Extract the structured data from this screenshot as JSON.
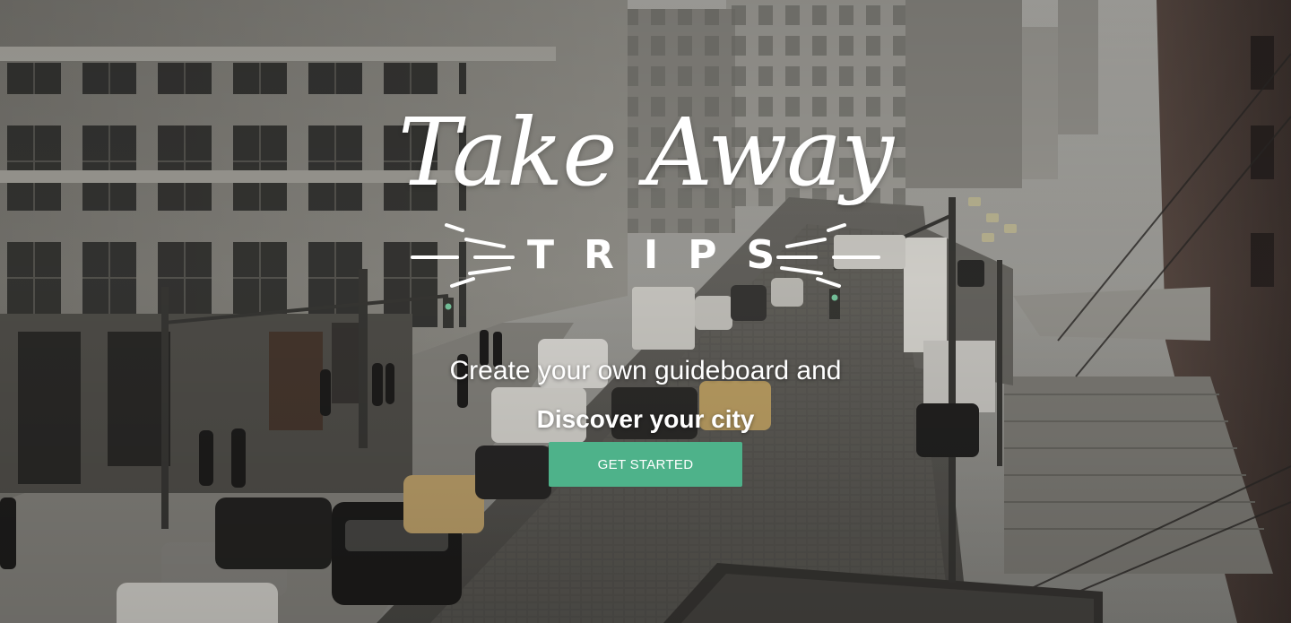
{
  "hero": {
    "logo": {
      "script": "Take Away",
      "sub": "TRIPS"
    },
    "tagline": "Create your own guideboard and",
    "headline": "Discover your city",
    "cta_label": "GET STARTED"
  },
  "colors": {
    "accent": "#4eb28a",
    "text": "#ffffff"
  }
}
